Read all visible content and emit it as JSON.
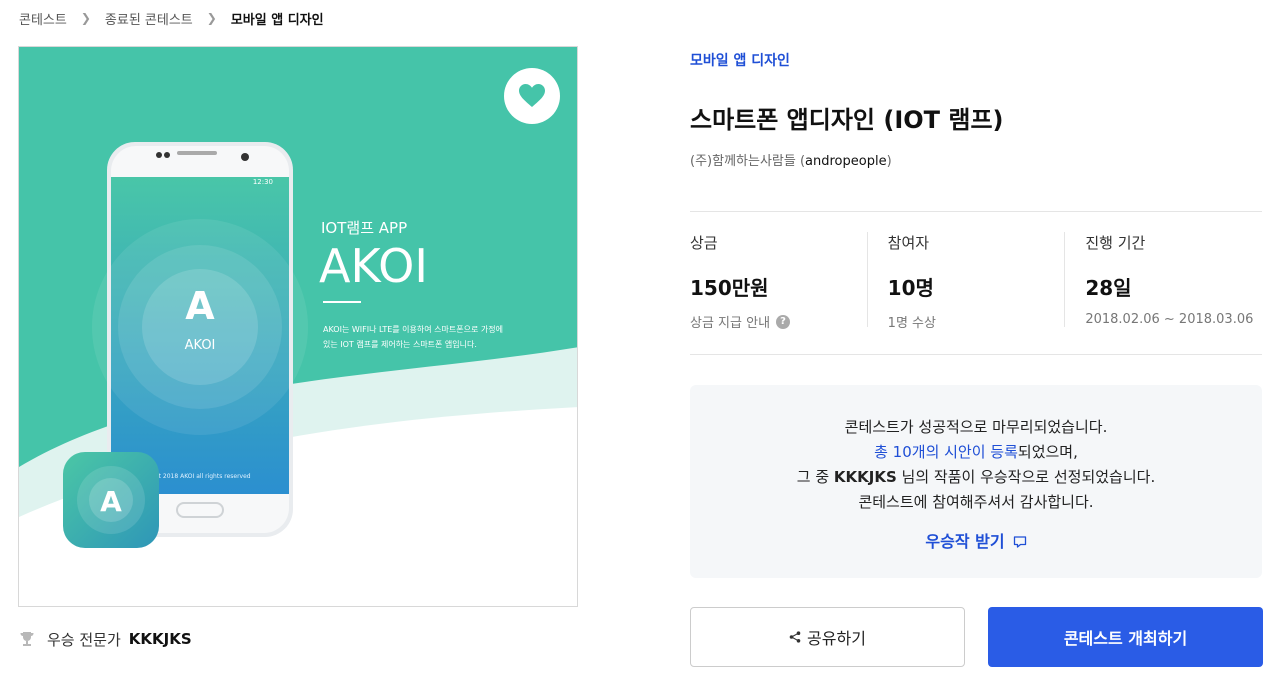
{
  "breadcrumb": [
    "콘테스트",
    "종료된 콘테스트",
    "모바일 앱 디자인"
  ],
  "hero": {
    "app_subtitle": "IOT램프 APP",
    "app_name": "AKOI",
    "app_desc_line1": "AKOI는 WIFI나 LTE를 이용하여 스마트폰으로 가정에",
    "app_desc_line2": "있는 IOT 램프를 제어하는 스마트폰 앱입니다.",
    "phone_time": "12:30",
    "logo_text": "AKOI",
    "copyright": "ight 2018 AKOI all rights reserved",
    "heart_icon": "heart-icon",
    "colors": {
      "bg": "#45c4a9",
      "accent": "#2fb59d"
    }
  },
  "winner_line": {
    "label": "우승 전문가",
    "name": "KKKJKS"
  },
  "contest": {
    "category": "모바일 앱 디자인",
    "title": "스마트폰 앱디자인 (IOT 램프)",
    "host_prefix": "(주)함께하는사람들 (",
    "host_id": "andropeople",
    "host_suffix": ")"
  },
  "stats": [
    {
      "label": "상금",
      "value": "150만원",
      "sub": "상금 지급 안내"
    },
    {
      "label": "참여자",
      "value": "10명",
      "sub": "1명 수상"
    },
    {
      "label": "진행 기간",
      "value": "28일",
      "sub": "2018.02.06 ~ 2018.03.06"
    }
  ],
  "notice": {
    "line1": "콘테스트가 성공적으로 마무리되었습니다.",
    "line2_link": "총 10개의 시안이 등록",
    "line2_rest": "되었으며,",
    "line3_prefix": "그 중 ",
    "line3_winner": "KKKJKS",
    "line3_rest": " 님의 작품이 우승작으로 선정되었습니다.",
    "line4": "콘테스트에 참여해주셔서 감사합니다.",
    "cta": "우승작 받기"
  },
  "buttons": {
    "share": "공유하기",
    "host": "콘테스트 개최하기"
  },
  "colors": {
    "primary": "#2a5ce6",
    "link": "#1f4fd6"
  }
}
